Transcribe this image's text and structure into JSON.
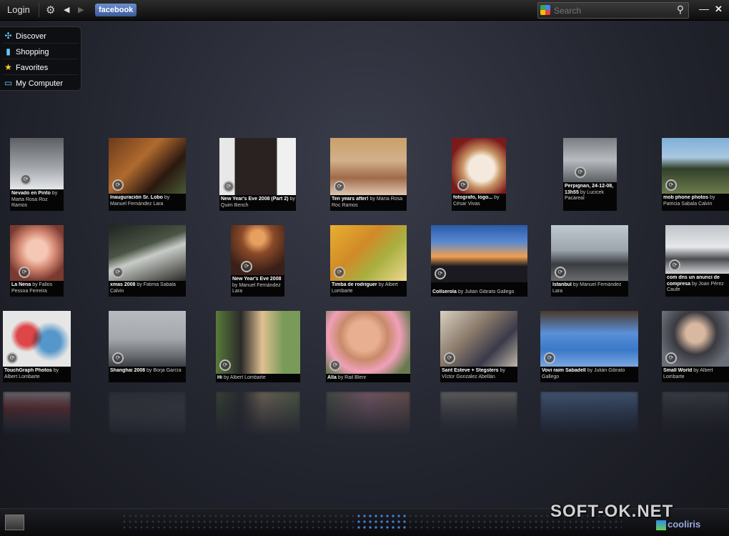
{
  "topbar": {
    "login_label": "Login",
    "gear_icon": "gear-icon",
    "back_icon": "back-arrow-icon",
    "forward_icon": "forward-arrow-icon",
    "service_tab": "facebook",
    "service_tab_color": "#3b5998",
    "search_placeholder": "Search",
    "minimize_icon": "minimize-icon",
    "close_icon": "close-icon"
  },
  "menu": {
    "items": [
      {
        "label": "Discover",
        "icon": "discover-icon"
      },
      {
        "label": "Shopping",
        "icon": "shopping-icon"
      },
      {
        "label": "Favorites",
        "icon": "star-icon"
      },
      {
        "label": "My Computer",
        "icon": "monitor-icon"
      }
    ]
  },
  "photos": [
    {
      "title": "Nevado en Pinto",
      "author": "by Marta Rosa Roz Ramos"
    },
    {
      "title": "Inauguración Sr. Lobo",
      "author": "by Manuel Fernández Lara"
    },
    {
      "title": "New Year's Eve 2008 (Part 2)",
      "author": "by Quim Bench"
    },
    {
      "title": "Ten years after!",
      "author": "by María Rosa Roc Ramos"
    },
    {
      "title": "fotografo, logo...",
      "author": "by César Vivas"
    },
    {
      "title": "Perpignan, 24-12-08, 13h55",
      "author": "by Lucicek Pacareal"
    },
    {
      "title": "mob phone photos",
      "author": "by Patricia Sabala Calvin"
    },
    {
      "title": "La Nena",
      "author": "by Fallos Pessoa Ferreira"
    },
    {
      "title": "xmas 2008",
      "author": "by Fatima Sabala Calvin"
    },
    {
      "title": "New Year's Eve 2008",
      "author": "by Manuel Fernández Lara"
    },
    {
      "title": "Timba de rodriguer",
      "author": "by Albert Lombarte"
    },
    {
      "title": "Collserola",
      "author": "by Julián Gibrato Gallego"
    },
    {
      "title": "Istanbul",
      "author": "by Manuel Fernández Lara"
    },
    {
      "title": "com dns un anunci de compresa",
      "author": "by Joan Pérez Caufe"
    },
    {
      "title": "TouchGraph Photos",
      "author": "by Albert Lombarte"
    },
    {
      "title": "Shanghai 2008",
      "author": "by Borja García"
    },
    {
      "title": "Hi",
      "author": "by Albert Lombarte"
    },
    {
      "title": "Alla",
      "author": "by Rail Blenr"
    },
    {
      "title": "Sant Esteve + Stegsters",
      "author": "by Víctor Gonzalez Abellán"
    },
    {
      "title": "Vovi raim Sabadell",
      "author": "by Julián Gibrato Gallego"
    },
    {
      "title": "Small World",
      "author": "by Albert Lombarte"
    }
  ],
  "bottombar": {
    "brand": "cooliris"
  },
  "watermark": "SOFT-OK.NET"
}
